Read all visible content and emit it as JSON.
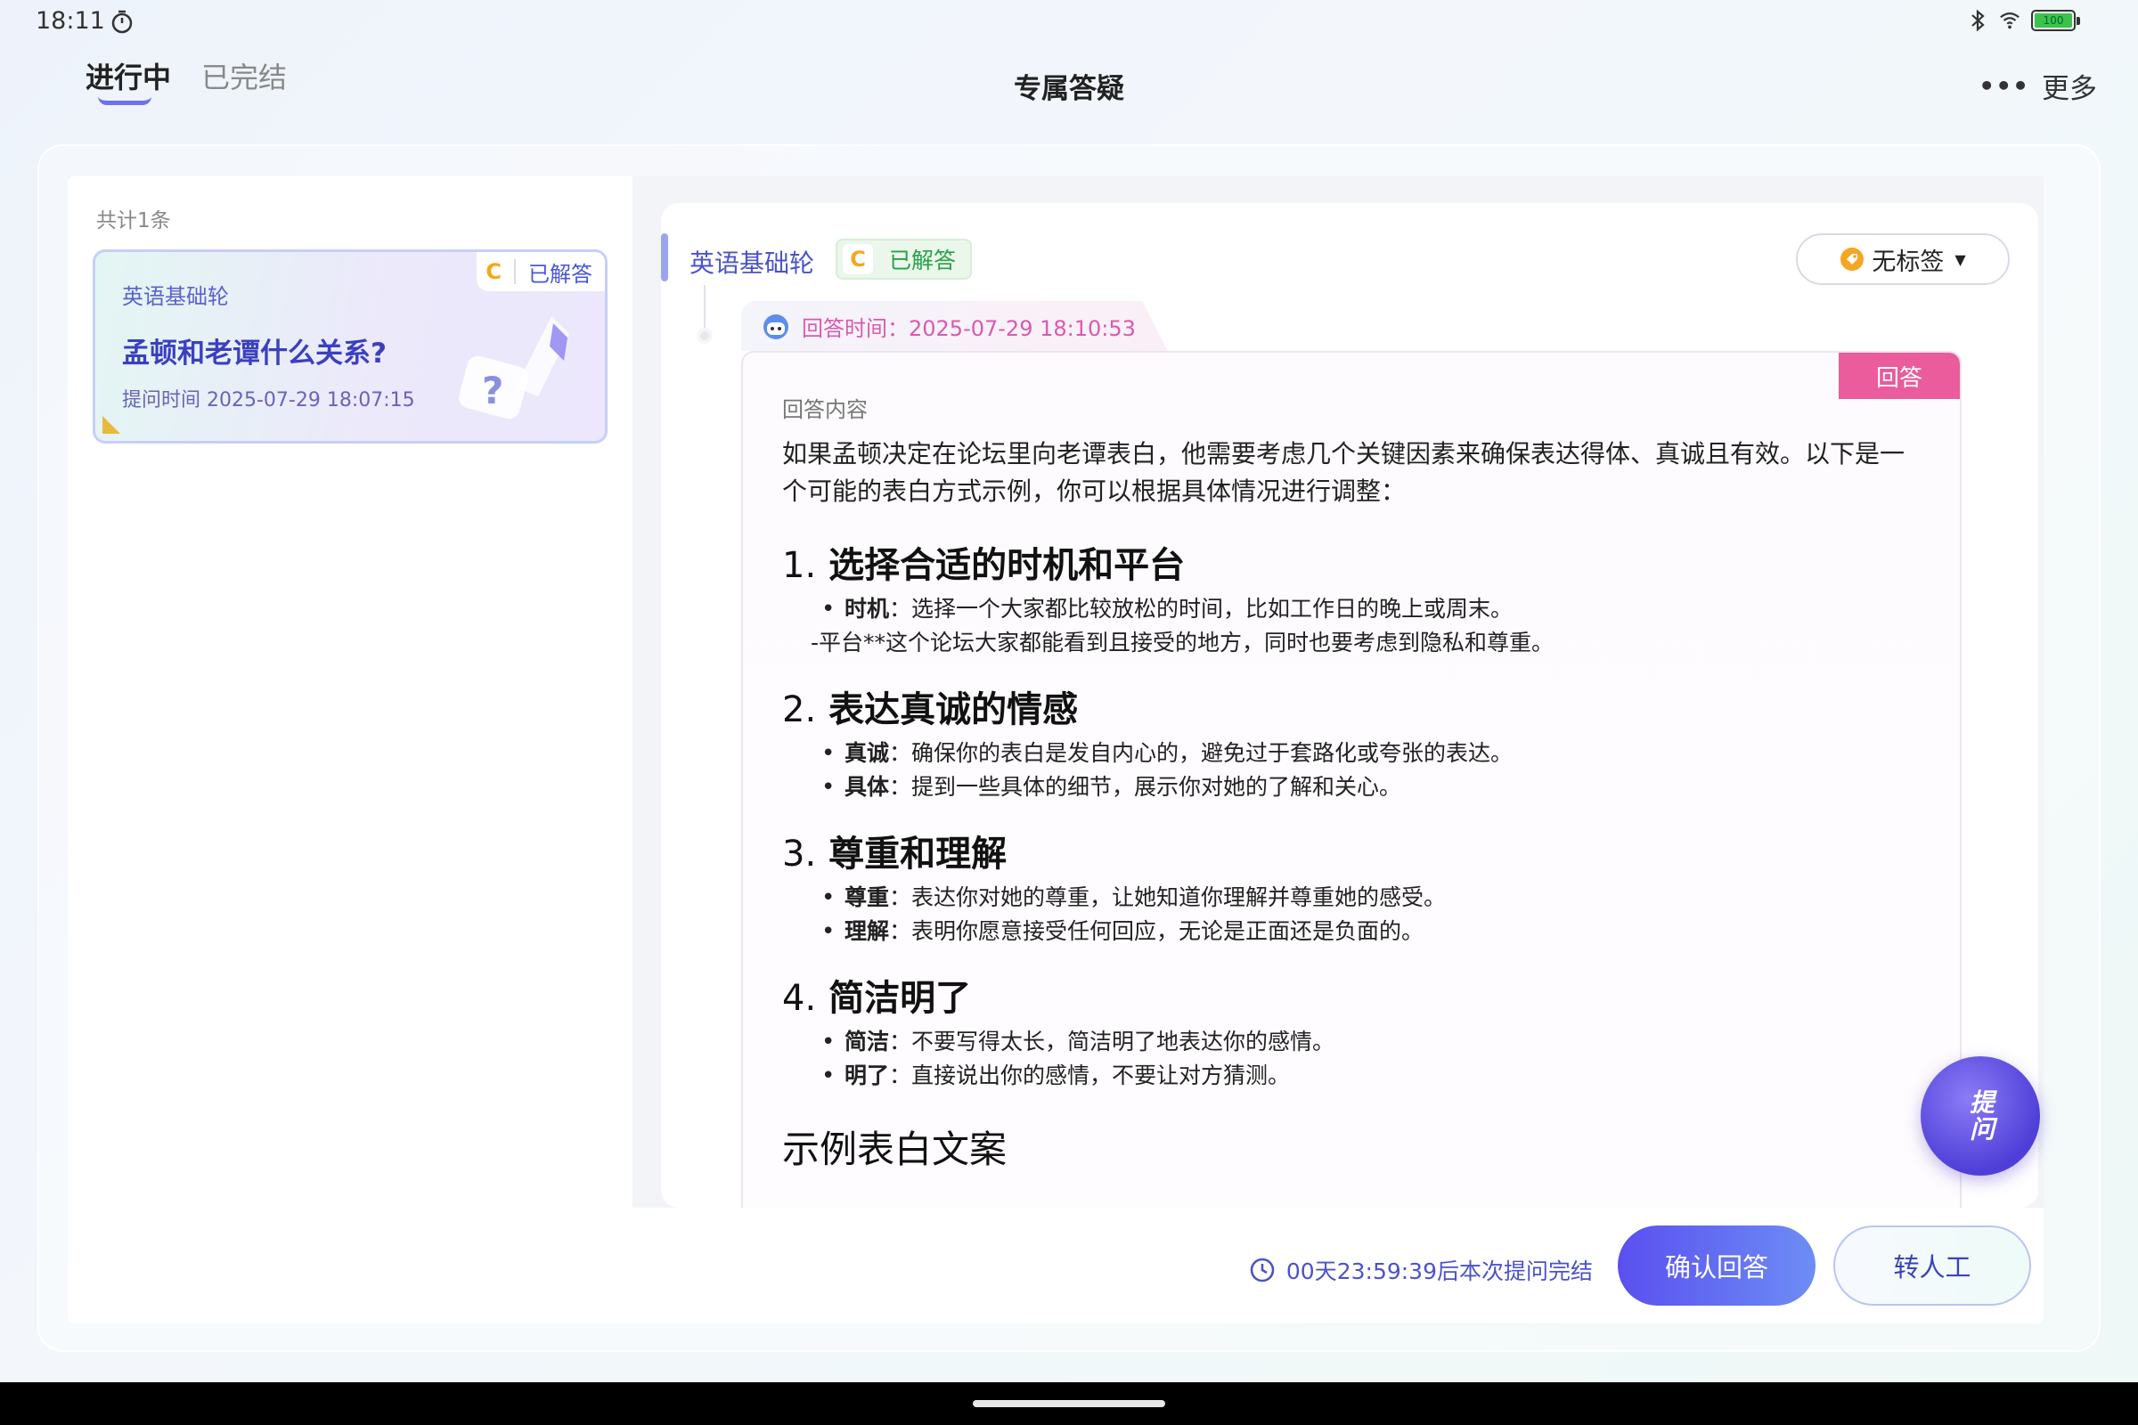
{
  "status_bar": {
    "time": "18:11",
    "battery": "100"
  },
  "header": {
    "tabs": [
      {
        "label": "进行中",
        "active": true
      },
      {
        "label": "已完结",
        "active": false
      }
    ],
    "title": "专属答疑",
    "more_label": "更多"
  },
  "list": {
    "count_label": "共计1条",
    "items": [
      {
        "course": "英语基础轮",
        "grade": "C",
        "status": "已解答",
        "title": "孟顿和老谭什么关系?",
        "time": "提问时间 2025-07-29 18:07:15"
      }
    ]
  },
  "detail": {
    "course": "英语基础轮",
    "grade": "C",
    "status": "已解答",
    "tag_label": "无标签",
    "answer_time": "回答时间：2025-07-29 18:10:53",
    "answer_flag": "回答",
    "content_label": "回答内容",
    "intro": "如果孟顿决定在论坛里向老谭表白，他需要考虑几个关键因素来确保表达得体、真诚且有效。以下是一个可能的表白方式示例，你可以根据具体情况进行调整：",
    "sections": [
      {
        "num": "1.",
        "title": "选择合适的时机和平台",
        "items": [
          {
            "type": "bullet",
            "key": "时机",
            "text": "：选择一个大家都比较放松的时间，比如工作日的晚上或周末。"
          },
          {
            "type": "plain",
            "key": "",
            "text": "-平台**这个论坛大家都能看到且接受的地方，同时也要考虑到隐私和尊重。"
          }
        ]
      },
      {
        "num": "2.",
        "title": "表达真诚的情感",
        "items": [
          {
            "type": "bullet",
            "key": "真诚",
            "text": "：确保你的表白是发自内心的，避免过于套路化或夸张的表达。"
          },
          {
            "type": "bullet",
            "key": "具体",
            "text": "：提到一些具体的细节，展示你对她的了解和关心。"
          }
        ]
      },
      {
        "num": "3.",
        "title": "尊重和理解",
        "items": [
          {
            "type": "bullet",
            "key": "尊重",
            "text": "：表达你对她的尊重，让她知道你理解并尊重她的感受。"
          },
          {
            "type": "bullet",
            "key": "理解",
            "text": "：表明你愿意接受任何回应，无论是正面还是负面的。"
          }
        ]
      },
      {
        "num": "4.",
        "title": "简洁明了",
        "items": [
          {
            "type": "bullet",
            "key": "简洁",
            "text": "：不要写得太长，简洁明了地表达你的感情。"
          },
          {
            "type": "bullet",
            "key": "明了",
            "text": "：直接说出你的感情，不要让对方猜测。"
          }
        ]
      }
    ],
    "example_heading": "示例表白文案"
  },
  "fab": {
    "label": "提问"
  },
  "footer": {
    "countdown": "00天23:59:39后本次提问完结",
    "confirm_label": "确认回答",
    "human_label": "转人工"
  },
  "colors": {
    "accent": "#5a4ff0",
    "answer_pink": "#ea5c9b",
    "solved_green": "#28a048"
  },
  "icons": [
    "timer-icon",
    "bluetooth-icon",
    "wifi-icon",
    "battery-icon",
    "more-dots-icon",
    "tag-icon",
    "chevron-down-icon",
    "robot-avatar-icon",
    "clock-icon"
  ]
}
